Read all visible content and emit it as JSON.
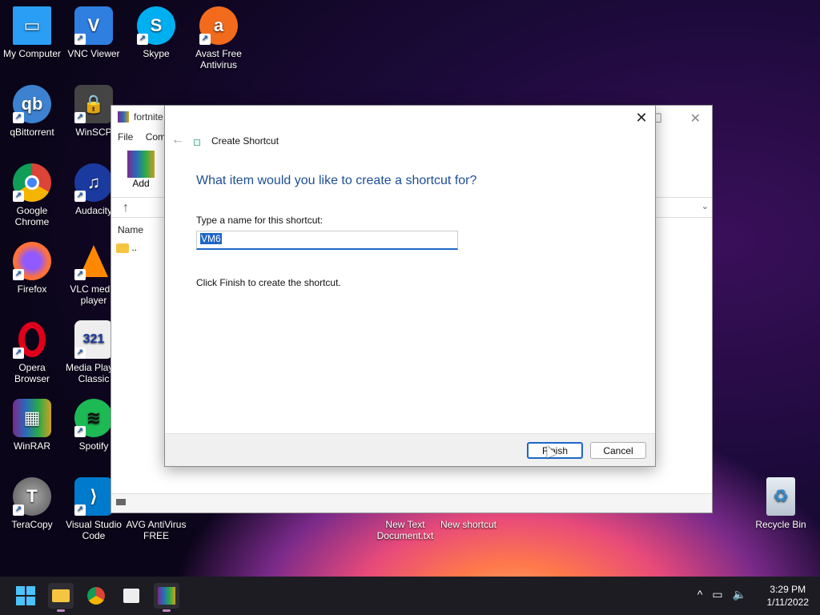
{
  "desktop": {
    "icons": [
      {
        "label": "My Computer",
        "icon": "computer-icon",
        "color": "#1e90ff"
      },
      {
        "label": "VNC Viewer",
        "icon": "vnc-icon",
        "color": "#2f7fe0"
      },
      {
        "label": "Skype",
        "icon": "skype-icon",
        "color": "#00aff0"
      },
      {
        "label": "Avast Free Antivirus",
        "icon": "avast-icon",
        "color": "#f26b1d"
      },
      {
        "label": "qBittorrent",
        "icon": "qbittorrent-icon",
        "color": "#3c82d0"
      },
      {
        "label": "WinSCP",
        "icon": "winscp-icon",
        "color": "#555"
      },
      {
        "label": "Google Chrome",
        "icon": "chrome-icon",
        "color": "#e0b000"
      },
      {
        "label": "Audacity",
        "icon": "audacity-icon",
        "color": "#1a3aa0"
      },
      {
        "label": "Firefox",
        "icon": "firefox-icon",
        "color": "#ff7139"
      },
      {
        "label": "VLC media player",
        "icon": "vlc-icon",
        "color": "#ff8800"
      },
      {
        "label": "Opera Browser",
        "icon": "opera-icon",
        "color": "#e0001b"
      },
      {
        "label": "Media Player Classic",
        "icon": "media-player-icon",
        "color": "#ddd"
      },
      {
        "label": "WinRAR",
        "icon": "winrar-icon",
        "color": "#8a2a6a"
      },
      {
        "label": "Spotify",
        "icon": "spotify-icon",
        "color": "#1db954"
      },
      {
        "label": "TeraCopy",
        "icon": "teracopy-icon",
        "color": "#777"
      },
      {
        "label": "Visual Studio Code",
        "icon": "vscode-icon",
        "color": "#007acc"
      },
      {
        "label": "AVG AntiVirus FREE",
        "icon": "avg-icon",
        "color": "#ddd"
      },
      {
        "label": "New Text Document.txt",
        "icon": "text-file-icon",
        "color": "#ddd"
      },
      {
        "label": "New shortcut",
        "icon": "shortcut-icon",
        "color": "#ddd"
      },
      {
        "label": "Recycle Bin",
        "icon": "recycle-bin-icon",
        "color": "#cfd8e0"
      }
    ]
  },
  "explorer": {
    "title": "fortnite",
    "menu": [
      "File",
      "Comm"
    ],
    "add_label": "Add",
    "column_name": "Name",
    "row_parent": ".."
  },
  "dialog": {
    "title": "Create Shortcut",
    "heading": "What item would you like to create a shortcut for?",
    "name_label": "Type a name for this shortcut:",
    "name_value": "VM6",
    "hint": "Click Finish to create the shortcut.",
    "finish_label": "Finish",
    "cancel_label": "Cancel"
  },
  "taskbar": {
    "time": "3:29 PM",
    "date": "1/11/2022"
  }
}
